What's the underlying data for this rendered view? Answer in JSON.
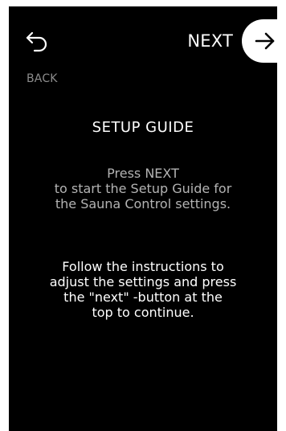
{
  "header": {
    "back": {
      "icon": "undo-arrow-icon",
      "label": "BACK"
    },
    "next": {
      "icon": "arrow-right-icon",
      "label": "NEXT"
    }
  },
  "main": {
    "title": "SETUP GUIDE",
    "intro": "Press NEXT\nto start the Setup Guide for\nthe Sauna Control settings.",
    "instructions": "Follow the instructions to\nadjust the settings and press\nthe \"next\" -button at the\ntop to continue."
  },
  "colors": {
    "background": "#000000",
    "text_primary": "#ffffff",
    "text_secondary": "#b3b3b3",
    "back_label": "#8c8c8c",
    "next_button_bg": "#ffffff"
  }
}
